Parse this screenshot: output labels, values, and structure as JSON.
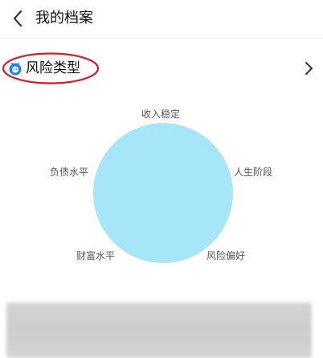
{
  "header": {
    "title": "我的档案",
    "back_icon": "chevron-left-icon"
  },
  "section": {
    "title": "风险类型",
    "icon": "risk-face-icon",
    "chevron_icon": "chevron-right-icon",
    "accent_color": "#1e88e5",
    "highlight_color": "#d0202a"
  },
  "chart_data": {
    "type": "radar",
    "dimensions": [
      "收入稳定",
      "人生阶段",
      "风险偏好",
      "财富水平",
      "负债水平"
    ],
    "fill_color": "#a6e6f8"
  },
  "card": {
    "state": "blurred"
  }
}
